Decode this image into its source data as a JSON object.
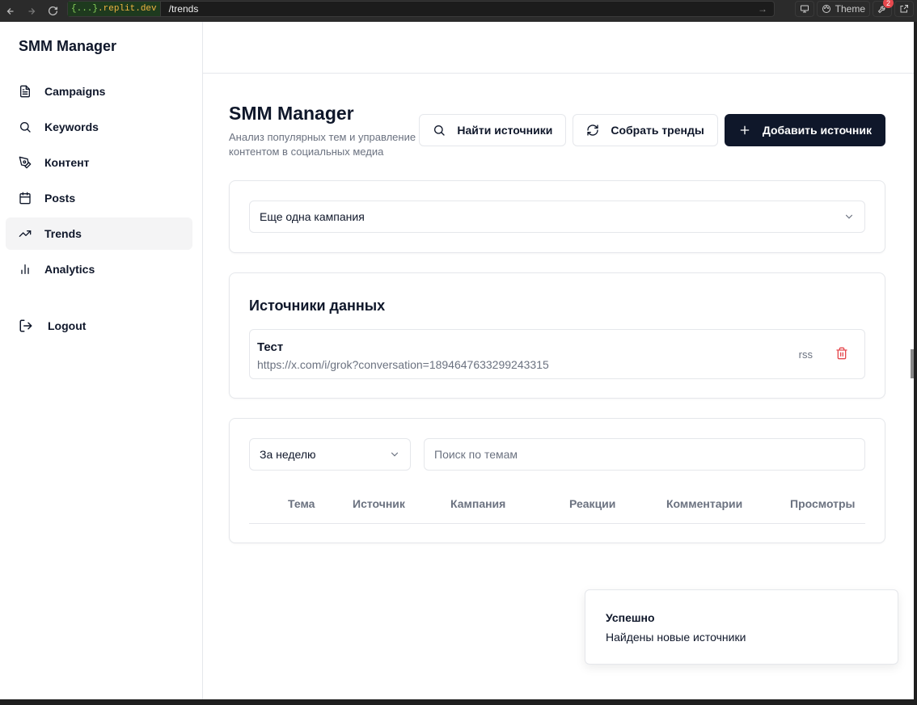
{
  "browser": {
    "host_prefix": "{...}",
    "host": ".replit.dev",
    "path": "/trends",
    "theme_label": "Theme",
    "badge_count": "2"
  },
  "sidebar": {
    "brand": "SMM Manager",
    "items": [
      {
        "label": "Campaigns",
        "icon": "file-text-icon"
      },
      {
        "label": "Keywords",
        "icon": "search-icon"
      },
      {
        "label": "Контент",
        "icon": "pen-icon"
      },
      {
        "label": "Posts",
        "icon": "calendar-icon"
      },
      {
        "label": "Trends",
        "icon": "trending-up-icon",
        "active": true
      },
      {
        "label": "Analytics",
        "icon": "bar-chart-icon"
      }
    ],
    "logout": "Logout"
  },
  "header": {
    "title": "SMM Manager",
    "subtitle": "Анализ популярных тем и управление контентом в социальных медиа",
    "buttons": {
      "find_sources": "Найти источники",
      "collect_trends": "Собрать тренды",
      "add_source": "Добавить источник"
    }
  },
  "campaign_select": {
    "value": "Еще одна кампания"
  },
  "sources": {
    "title": "Источники данных",
    "items": [
      {
        "name": "Тест",
        "url": "https://x.com/i/grok?conversation=1894647633299243315",
        "type": "rss"
      }
    ]
  },
  "trends": {
    "period": "За неделю",
    "search_placeholder": "Поиск по темам",
    "columns": [
      "Тема",
      "Источник",
      "Кампания",
      "Реакции",
      "Комментарии",
      "Просмотры"
    ]
  },
  "toast": {
    "title": "Успешно",
    "message": "Найдены новые источники"
  },
  "colors": {
    "primary": "#0f172a",
    "muted": "#6b7280",
    "border": "#e5e7eb",
    "danger": "#e5484d",
    "active_bg": "#f4f4f5"
  }
}
